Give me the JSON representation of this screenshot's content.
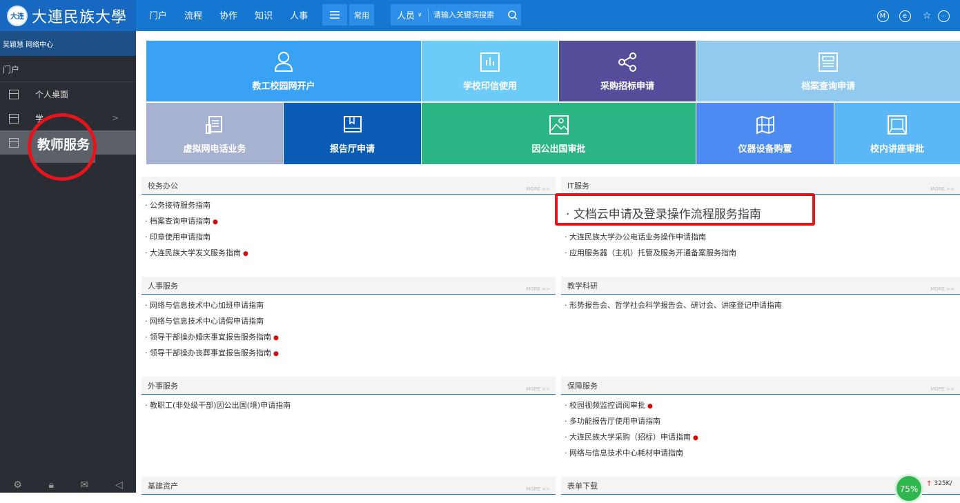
{
  "logo": {
    "seal": "大连",
    "text": "大連民族大學"
  },
  "nav": [
    "门户",
    "流程",
    "协作",
    "知识",
    "人事"
  ],
  "common_label": "常用",
  "search": {
    "category": "人员",
    "placeholder": "请输入关键词搜索"
  },
  "top_icons": [
    "M",
    "e"
  ],
  "sidebar": {
    "user": "吴颖慧 网络中心",
    "section": "门户",
    "items": [
      {
        "label": "个人桌面"
      },
      {
        "label": "学"
      },
      {
        "label": ""
      }
    ],
    "zoom_label": "教师服务"
  },
  "tiles": [
    {
      "label": "教工校园网开户",
      "color": "#3aa2f5"
    },
    {
      "label": "学校印信使用",
      "color": "#6ccbf7"
    },
    {
      "label": "采购招标申请",
      "color": "#554d9a"
    },
    {
      "label": "档案查询申请",
      "color": "#92c9ef"
    },
    {
      "label": "虚拟网电话业务",
      "color": "#a6b2cf"
    },
    {
      "label": "报告厅申请",
      "color": "#0b5bb5"
    },
    {
      "label": "因公出国审批",
      "color": "#2bb585"
    },
    {
      "label": "仪器设备购置",
      "color": "#4c8bf2"
    },
    {
      "label": "校内讲座审批",
      "color": "#5bb7f5"
    }
  ],
  "panels": {
    "office": {
      "title": "校务办公",
      "items": [
        "公务接待服务指南",
        "档案查询申请指南",
        "印章使用申请指南",
        "大连民族大学发文服务指南"
      ]
    },
    "it": {
      "title": "IT服务",
      "items": [
        "文档云申请及登录操作流程服务指南",
        "大连民族大学办公电话业务操作申请指南",
        "应用服务器（主机）托管及服务开通备案服务指南"
      ]
    },
    "hr": {
      "title": "人事服务",
      "items": [
        "网络与信息技术中心加班申请指南",
        "网络与信息技术中心请假申请指南",
        "领导干部操办婚庆事宜报告服务指南",
        "领导干部操办丧葬事宜报告服务指南"
      ]
    },
    "teach": {
      "title": "教学科研",
      "items": [
        "形势报告会、哲学社会科学报告会、研讨会、讲座登记申请指南"
      ]
    },
    "foreign": {
      "title": "外事服务",
      "items": [
        "教职工(非处级干部)因公出国(境)申请指南"
      ]
    },
    "support": {
      "title": "保障服务",
      "items": [
        "校园视频监控调阅审批",
        "多功能报告厅使用申请指南",
        "大连民族大学采购（招标）申请指南",
        "网络与信息技术中心耗材申请指南"
      ]
    },
    "infra": {
      "title": "基建资产"
    },
    "forms": {
      "title": "表单下载"
    }
  },
  "more_label": "MORE >>",
  "speed": {
    "percent": "75%",
    "rate": "325K/"
  }
}
